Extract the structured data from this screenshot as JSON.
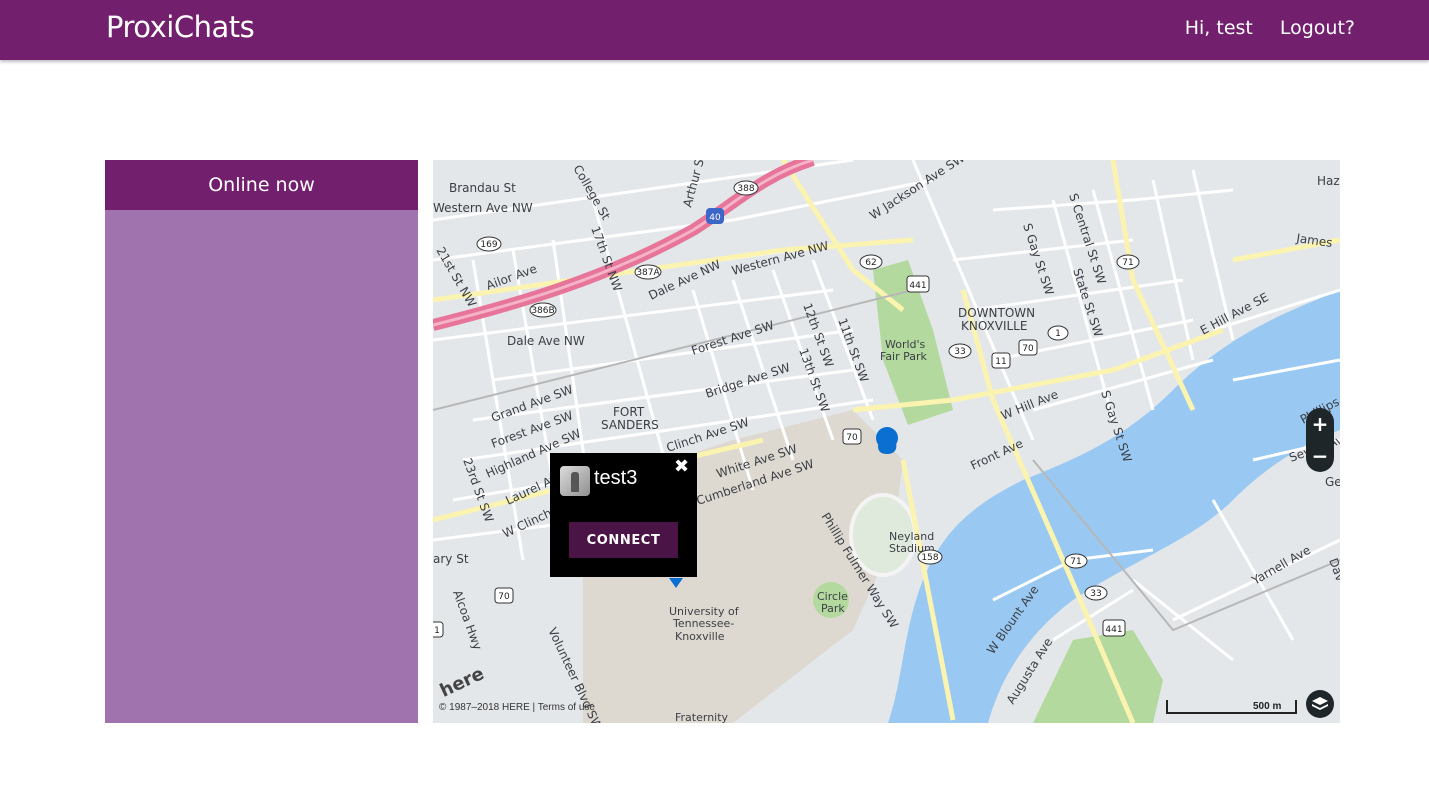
{
  "navbar": {
    "brand": "ProxiChats",
    "greeting": "Hi, test",
    "logout": "Logout?"
  },
  "sidebar": {
    "header": "Online now"
  },
  "map": {
    "popup": {
      "username": "test3",
      "close_glyph": "✖",
      "connect_label": "CONNECT",
      "avatar_icon": "user-avatar"
    },
    "zoom_in": "+",
    "zoom_out": "−",
    "attribution": "© 1987–2018 HERE | Terms of use",
    "scale_label": "500 m",
    "provider_logo": "here",
    "labels": {
      "brandau": "Brandau St",
      "college": "College St",
      "arthur": "Arthur St",
      "western1": "Western Ave NW",
      "western2": "Western Ave NW",
      "jackson": "W Jackson Ave SW",
      "james": "James",
      "aixor": "Ailor Ave",
      "st21": "21st St NW",
      "st17": "17th St NW",
      "dale1": "Dale Ave NW",
      "dale2": "Dale Ave NW",
      "forest": "Forest Ave SW",
      "bridge": "Bridge Ave SW",
      "st12": "12th St SW",
      "st11": "11th St SW",
      "st13": "13th St SW",
      "sgay": "S Gay St SW",
      "scentral": "S Central St SW",
      "state": "State St SW",
      "ehill": "E Hill Ave SE",
      "downtown1": "DOWNTOWN",
      "downtown2": "KNOXVILLE",
      "worlds1": "World's",
      "worlds2": "Fair Park",
      "grand": "Grand Ave SW",
      "forest2": "Forest Ave SW",
      "highland": "Highland Ave SW",
      "fort1": "FORT",
      "fort2": "SANDERS",
      "clinch": "Clinch Ave SW",
      "whitest": "White Ave SW",
      "cumberland": "Cumberland Ave SW",
      "laurel": "Laurel Ave",
      "wclinch": "W Clinch Ave",
      "st23": "23rd St SW",
      "whill": "W Hill Ave",
      "front": "Front Ave",
      "sgay2": "S Gay St SW",
      "phillips": "Phillips Ave",
      "sevier": "Sevier Ave",
      "neyland1": "Neyland",
      "neyland2": "Stadium",
      "phillip": "Phillip Fulmer Way SW",
      "circle1": "Circle",
      "circle2": "Park",
      "ut1": "University of",
      "ut2": "Tennessee-",
      "ut3": "Knoxville",
      "alcoa": "Alcoa Hwy",
      "volunteer": "Volunteer Blvd SW",
      "wblount": "W Blount Ave",
      "augusta": "Augusta Ave",
      "yarnell": "Yarnell Ave",
      "fraternity": "Fraternity",
      "rystreet": "ary St",
      "haz": "Haz",
      "gel": "Ge",
      "dav": "Dav"
    },
    "shields": {
      "i40": "40",
      "r388": "388",
      "r387a": "387A",
      "r386b": "386B",
      "r169": "169",
      "r62": "62",
      "r441a": "441",
      "r71a": "71",
      "r1": "1",
      "r33a": "33",
      "r11": "11",
      "r70a": "70",
      "r70b": "70",
      "r158": "158",
      "r71b": "71",
      "r33b": "33",
      "r441b": "441",
      "r70c": "70",
      "r1b": "1"
    }
  }
}
